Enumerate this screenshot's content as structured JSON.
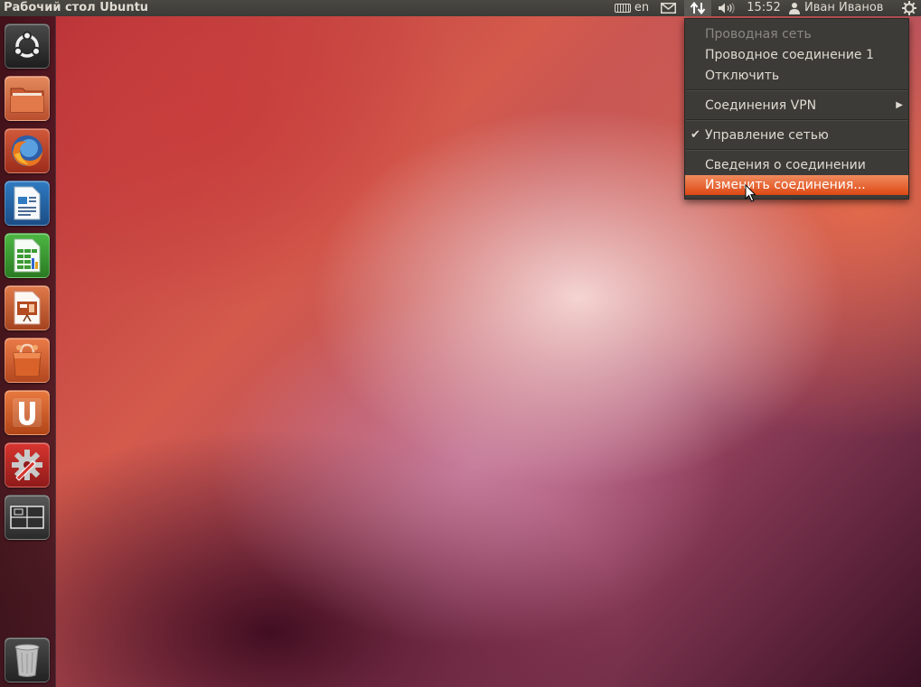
{
  "panel": {
    "title": "Рабочий стол Ubuntu",
    "keyboard_layout": "en",
    "clock": "15:52",
    "user_name": "Иван Иванов"
  },
  "launcher": {
    "items": [
      "dash-home",
      "files",
      "firefox",
      "libreoffice-writer",
      "libreoffice-calc",
      "libreoffice-impress",
      "software-center",
      "ubuntu-one",
      "system-settings",
      "workspace-switcher",
      "trash"
    ]
  },
  "network_menu": {
    "wired_header": "Проводная сеть",
    "wired_connection": "Проводное соединение 1",
    "disconnect": "Отключить",
    "vpn": "Соединения VPN",
    "manage_network": "Управление сетью",
    "connection_info": "Сведения о соединении",
    "edit_connections": "Изменить соединения..."
  },
  "colors": {
    "panel_bg": "#3c3b37",
    "panel_text": "#dfdbd2",
    "highlight": "#dd4814",
    "disabled_text": "#8b8882"
  }
}
